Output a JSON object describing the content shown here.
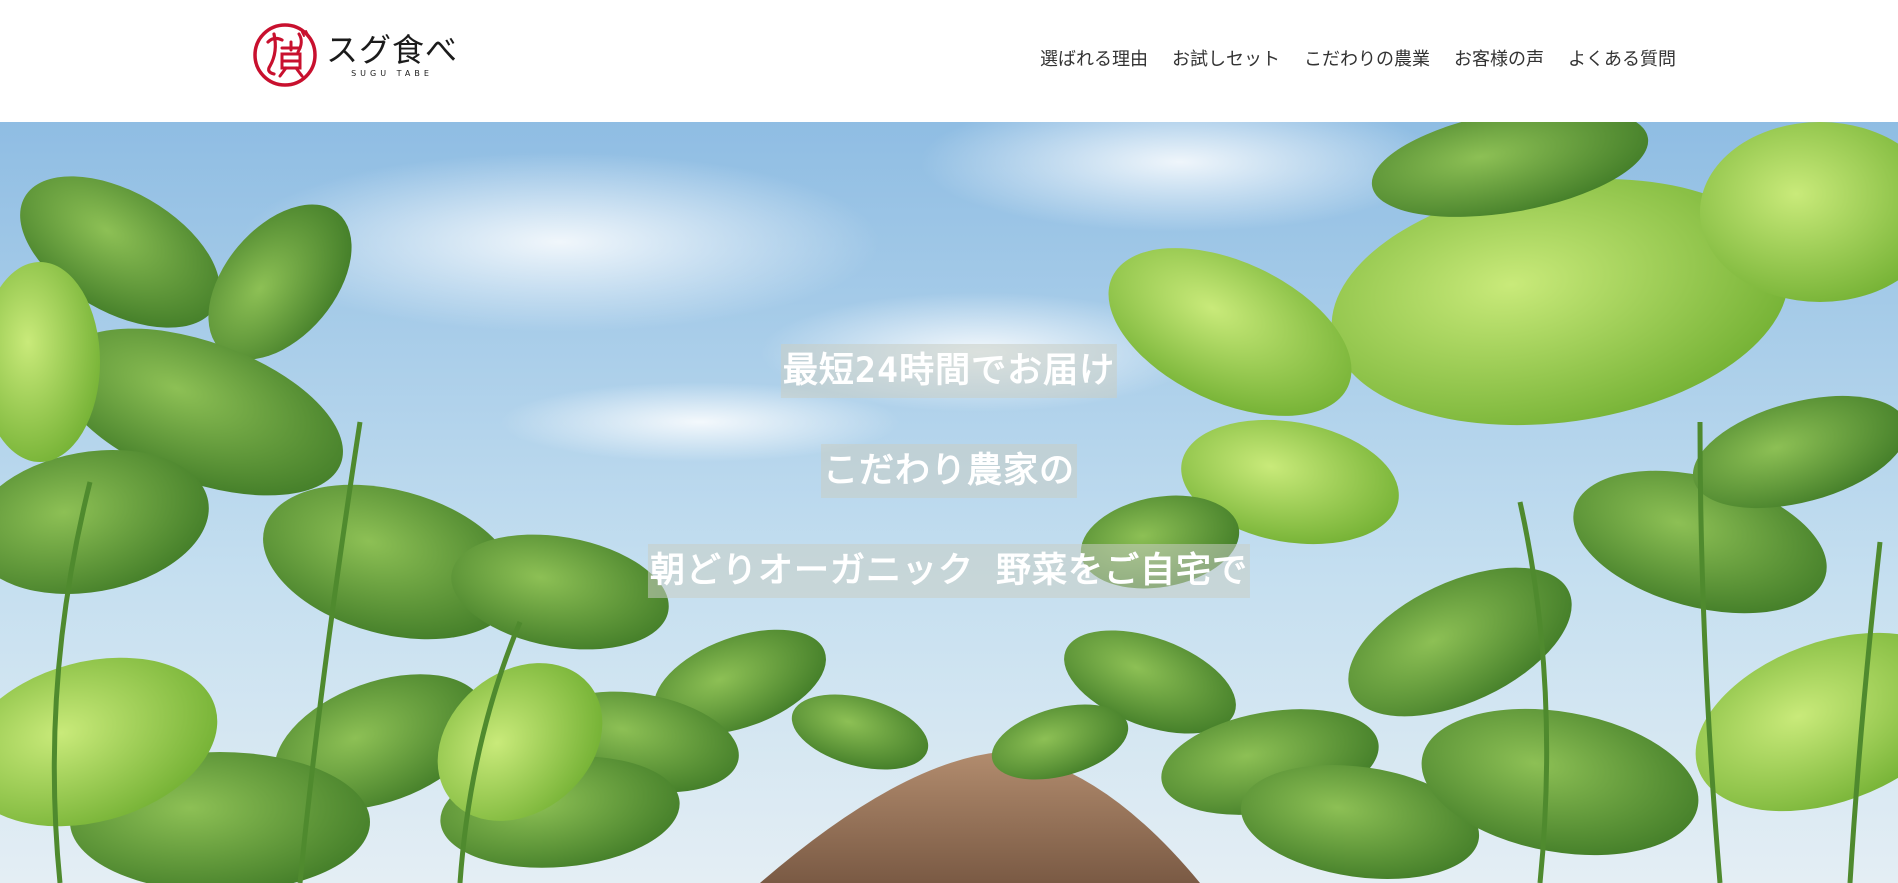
{
  "header": {
    "logo": {
      "mark_text": "すぐ食べ",
      "title": "スグ食べ",
      "subtitle": "SUGU TABE",
      "brand_color": "#c8102e"
    },
    "nav": [
      {
        "label": "選ばれる理由"
      },
      {
        "label": "お試しセット"
      },
      {
        "label": "こだわりの農業"
      },
      {
        "label": "お客様の声"
      },
      {
        "label": "よくある質問"
      }
    ]
  },
  "hero": {
    "lines": [
      "最短24時間でお届け",
      "こだわり農家の",
      "朝どりオーガニック 野菜をご自宅で"
    ],
    "colors": {
      "sky": "#a9cfea",
      "leaf_light": "#9ccc4a",
      "leaf_dark": "#4f8a2e",
      "soil": "#8a6a52"
    }
  }
}
